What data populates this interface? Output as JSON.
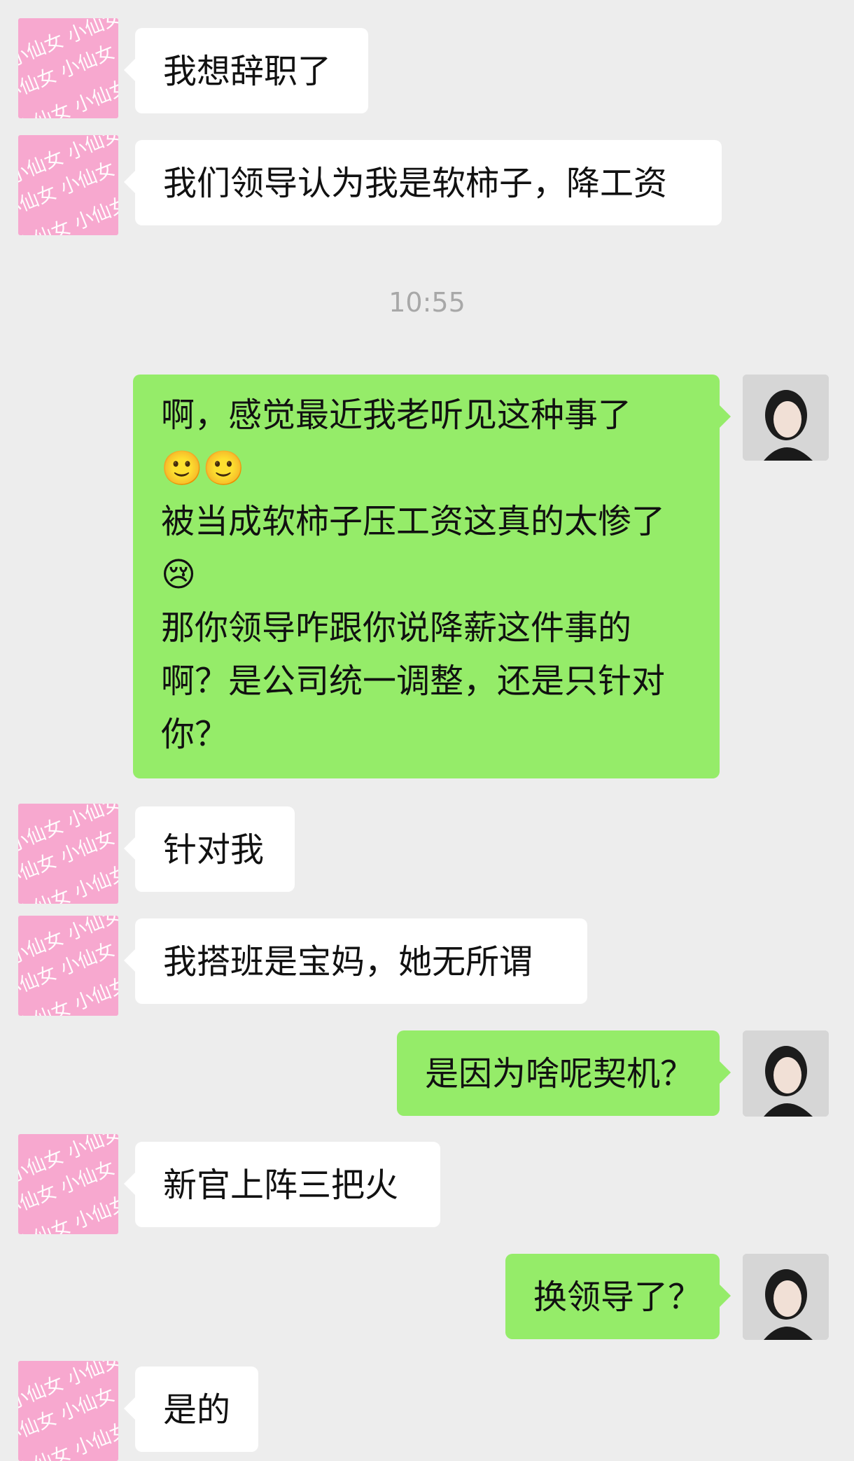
{
  "timestamp": "10:55",
  "avatars": {
    "left_watermark": "小仙女 小仙女 小仙女"
  },
  "messages": [
    {
      "side": "in",
      "lines": [
        "我想辞职了"
      ]
    },
    {
      "side": "in",
      "lines": [
        "我们领导认为我是软柿子，降工资"
      ]
    },
    {
      "side": "out",
      "lines": [
        "啊，感觉最近我老听见这种事了",
        "🙂🙂",
        "被当成软柿子压工资这真的太惨了",
        "😢",
        "那你领导咋跟你说降薪这件事的",
        "啊？是公司统一调整，还是只针对",
        "你？"
      ]
    },
    {
      "side": "in",
      "lines": [
        "针对我"
      ]
    },
    {
      "side": "in",
      "lines": [
        "我搭班是宝妈，她无所谓"
      ]
    },
    {
      "side": "out",
      "lines": [
        "是因为啥呢契机？"
      ]
    },
    {
      "side": "in",
      "lines": [
        "新官上阵三把火"
      ]
    },
    {
      "side": "out",
      "lines": [
        "换领导了？"
      ]
    },
    {
      "side": "in",
      "lines": [
        "是的"
      ]
    }
  ]
}
